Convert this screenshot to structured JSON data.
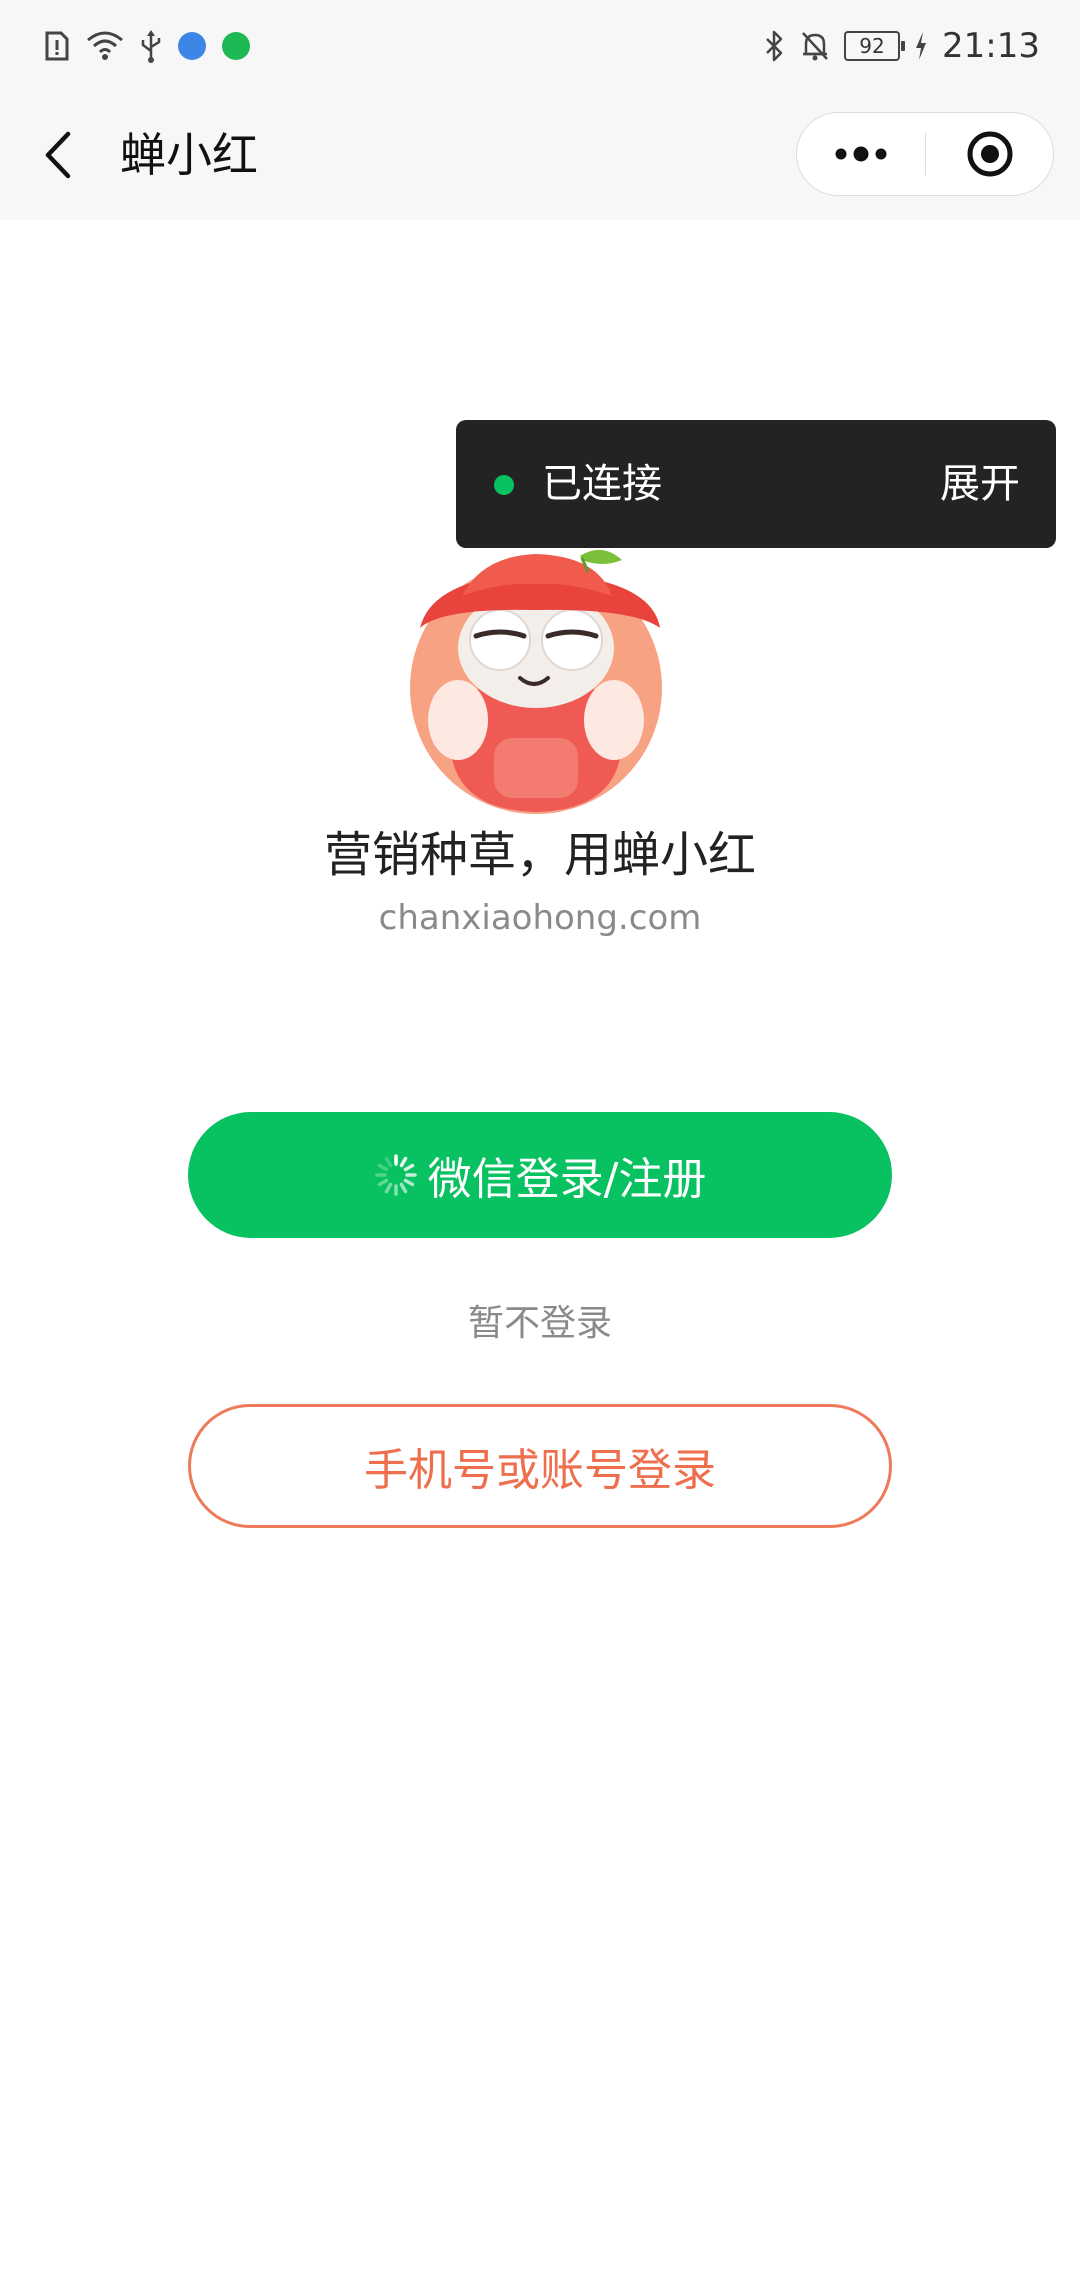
{
  "status_bar": {
    "time": "21:13",
    "battery": "92",
    "left_icons": [
      "alert-icon",
      "wifi-icon",
      "usb-icon",
      "app-icon-blue",
      "app-icon-green"
    ],
    "right_icons": [
      "bluetooth-icon",
      "mute-icon",
      "battery-icon",
      "charging-icon"
    ]
  },
  "navbar": {
    "title": "蝉小红",
    "icons": [
      "back-icon",
      "more-icon",
      "close-icon"
    ]
  },
  "toast": {
    "status": "已连接",
    "expand": "展开",
    "dot_color": "#08c160"
  },
  "main": {
    "slogan": "营销种草，用蝉小红",
    "domain": "chanxiaohong.com",
    "wechat_button": "微信登录/注册",
    "skip": "暂不登录",
    "phone_button": "手机号或账号登录"
  },
  "colors": {
    "wechat_green": "#08c160",
    "accent_orange": "#ee6f4d"
  }
}
